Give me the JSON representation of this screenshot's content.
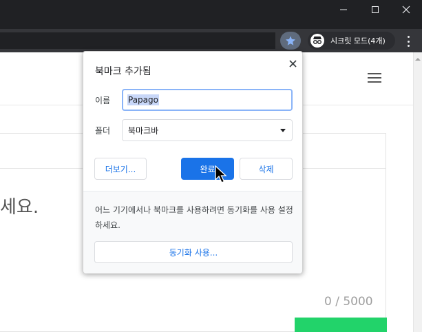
{
  "window": {
    "minimize_icon": "minimize-icon",
    "maximize_icon": "maximize-icon",
    "close_icon": "close-icon"
  },
  "toolbar": {
    "incognito_label": "시크릿 모드(4개)",
    "star_icon": "star-icon",
    "menu_icon": "kebab-menu-icon",
    "star_color": "#8ab4f8"
  },
  "page": {
    "partial_text": "세요.",
    "char_counter": "0 / 5000",
    "accent": "#22d36a"
  },
  "bookmark_popup": {
    "title": "북마크 추가됨",
    "name_label": "이름",
    "name_value": "Papago",
    "folder_label": "폴더",
    "folder_value": "북마크바",
    "more_button": "더보기...",
    "done_button": "완료",
    "delete_button": "삭제",
    "sync_message": "어느 기기에서나 북마크를 사용하려면 동기화를 사용 설정하세요.",
    "sync_button": "동기화 사용...",
    "primary_color": "#1a73e8"
  }
}
